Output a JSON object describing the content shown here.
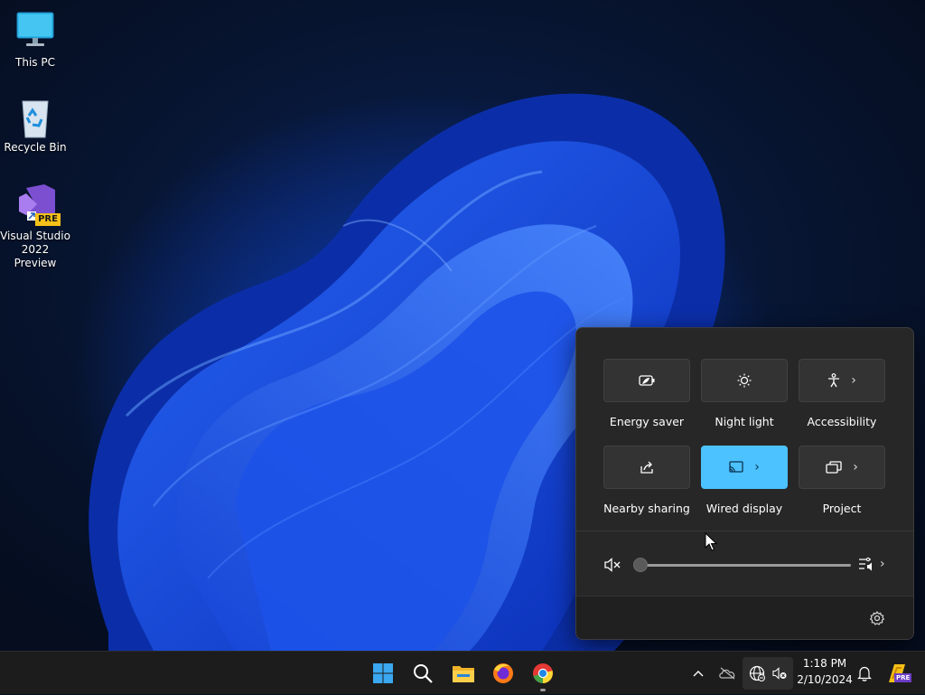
{
  "desktop": {
    "icons": [
      {
        "label": "This PC",
        "icon": "monitor-icon"
      },
      {
        "label": "Recycle Bin",
        "icon": "recycle-bin-icon"
      },
      {
        "label": "Visual Studio 2022 Preview",
        "line1": "Visual Studio",
        "line2": "2022 Preview",
        "badge": "PRE",
        "icon": "visual-studio-icon"
      }
    ]
  },
  "quick_settings": {
    "tiles": [
      {
        "label": "Energy saver",
        "icon": "energy-saver-icon",
        "active": false,
        "has_chevron": false
      },
      {
        "label": "Night light",
        "icon": "night-light-icon",
        "active": false,
        "has_chevron": false
      },
      {
        "label": "Accessibility",
        "icon": "accessibility-icon",
        "active": false,
        "has_chevron": true
      },
      {
        "label": "Nearby sharing",
        "icon": "share-icon",
        "active": false,
        "has_chevron": false
      },
      {
        "label": "Wired display",
        "icon": "cast-icon",
        "active": true,
        "has_chevron": true
      },
      {
        "label": "Project",
        "icon": "project-icon",
        "active": false,
        "has_chevron": true
      }
    ],
    "volume": {
      "level": 0,
      "muted": true
    },
    "accent_color": "#4cc2ff"
  },
  "taskbar": {
    "apps": [
      "start-icon",
      "search-icon",
      "file-explorer-icon",
      "firefox-icon",
      "chrome-icon"
    ],
    "tray": [
      "chevron-up-icon",
      "onedrive-icon",
      "network-icon",
      "volume-muted-icon",
      "bell-icon",
      "vs-preview-tray-icon"
    ],
    "tray_badge": "PRE",
    "time": "1:18 PM",
    "date": "2/10/2024"
  }
}
